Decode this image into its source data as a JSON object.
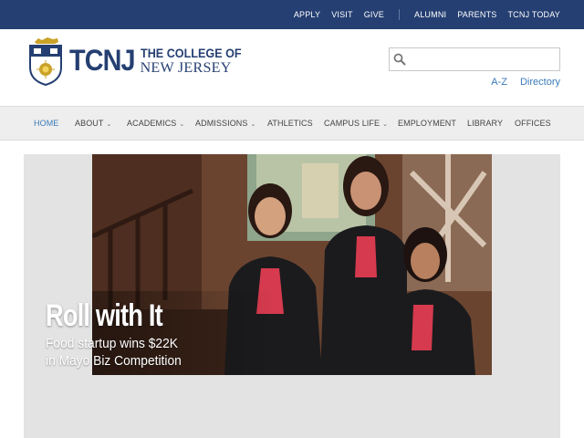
{
  "utility": {
    "links": [
      "APPLY",
      "VISIT",
      "GIVE"
    ],
    "links_right": [
      "ALUMNI",
      "PARENTS",
      "TCNJ TODAY"
    ]
  },
  "header": {
    "logo_abbr": "TCNJ",
    "logo_line1": "THE COLLEGE OF",
    "logo_line2": "NEW JERSEY",
    "search_placeholder": "",
    "az_label": "A-Z",
    "directory_label": "Directory"
  },
  "nav": {
    "home": "HOME",
    "about": "ABOUT",
    "academics": "ACADEMICS",
    "admissions": "ADMISSIONS",
    "athletics": "ATHLETICS",
    "campus_life": "CAMPUS LIFE",
    "employment": "EMPLOYMENT",
    "library": "LIBRARY",
    "offices": "OFFICES",
    "caret": "⌄"
  },
  "hero": {
    "headline": "Roll with It",
    "sub_line1": "Food startup wins $22K",
    "sub_line2": "in Mayo Biz Competition"
  },
  "colors": {
    "brand_navy": "#253f72",
    "link_blue": "#3a7ab8",
    "nav_bg": "#eeeeee"
  }
}
